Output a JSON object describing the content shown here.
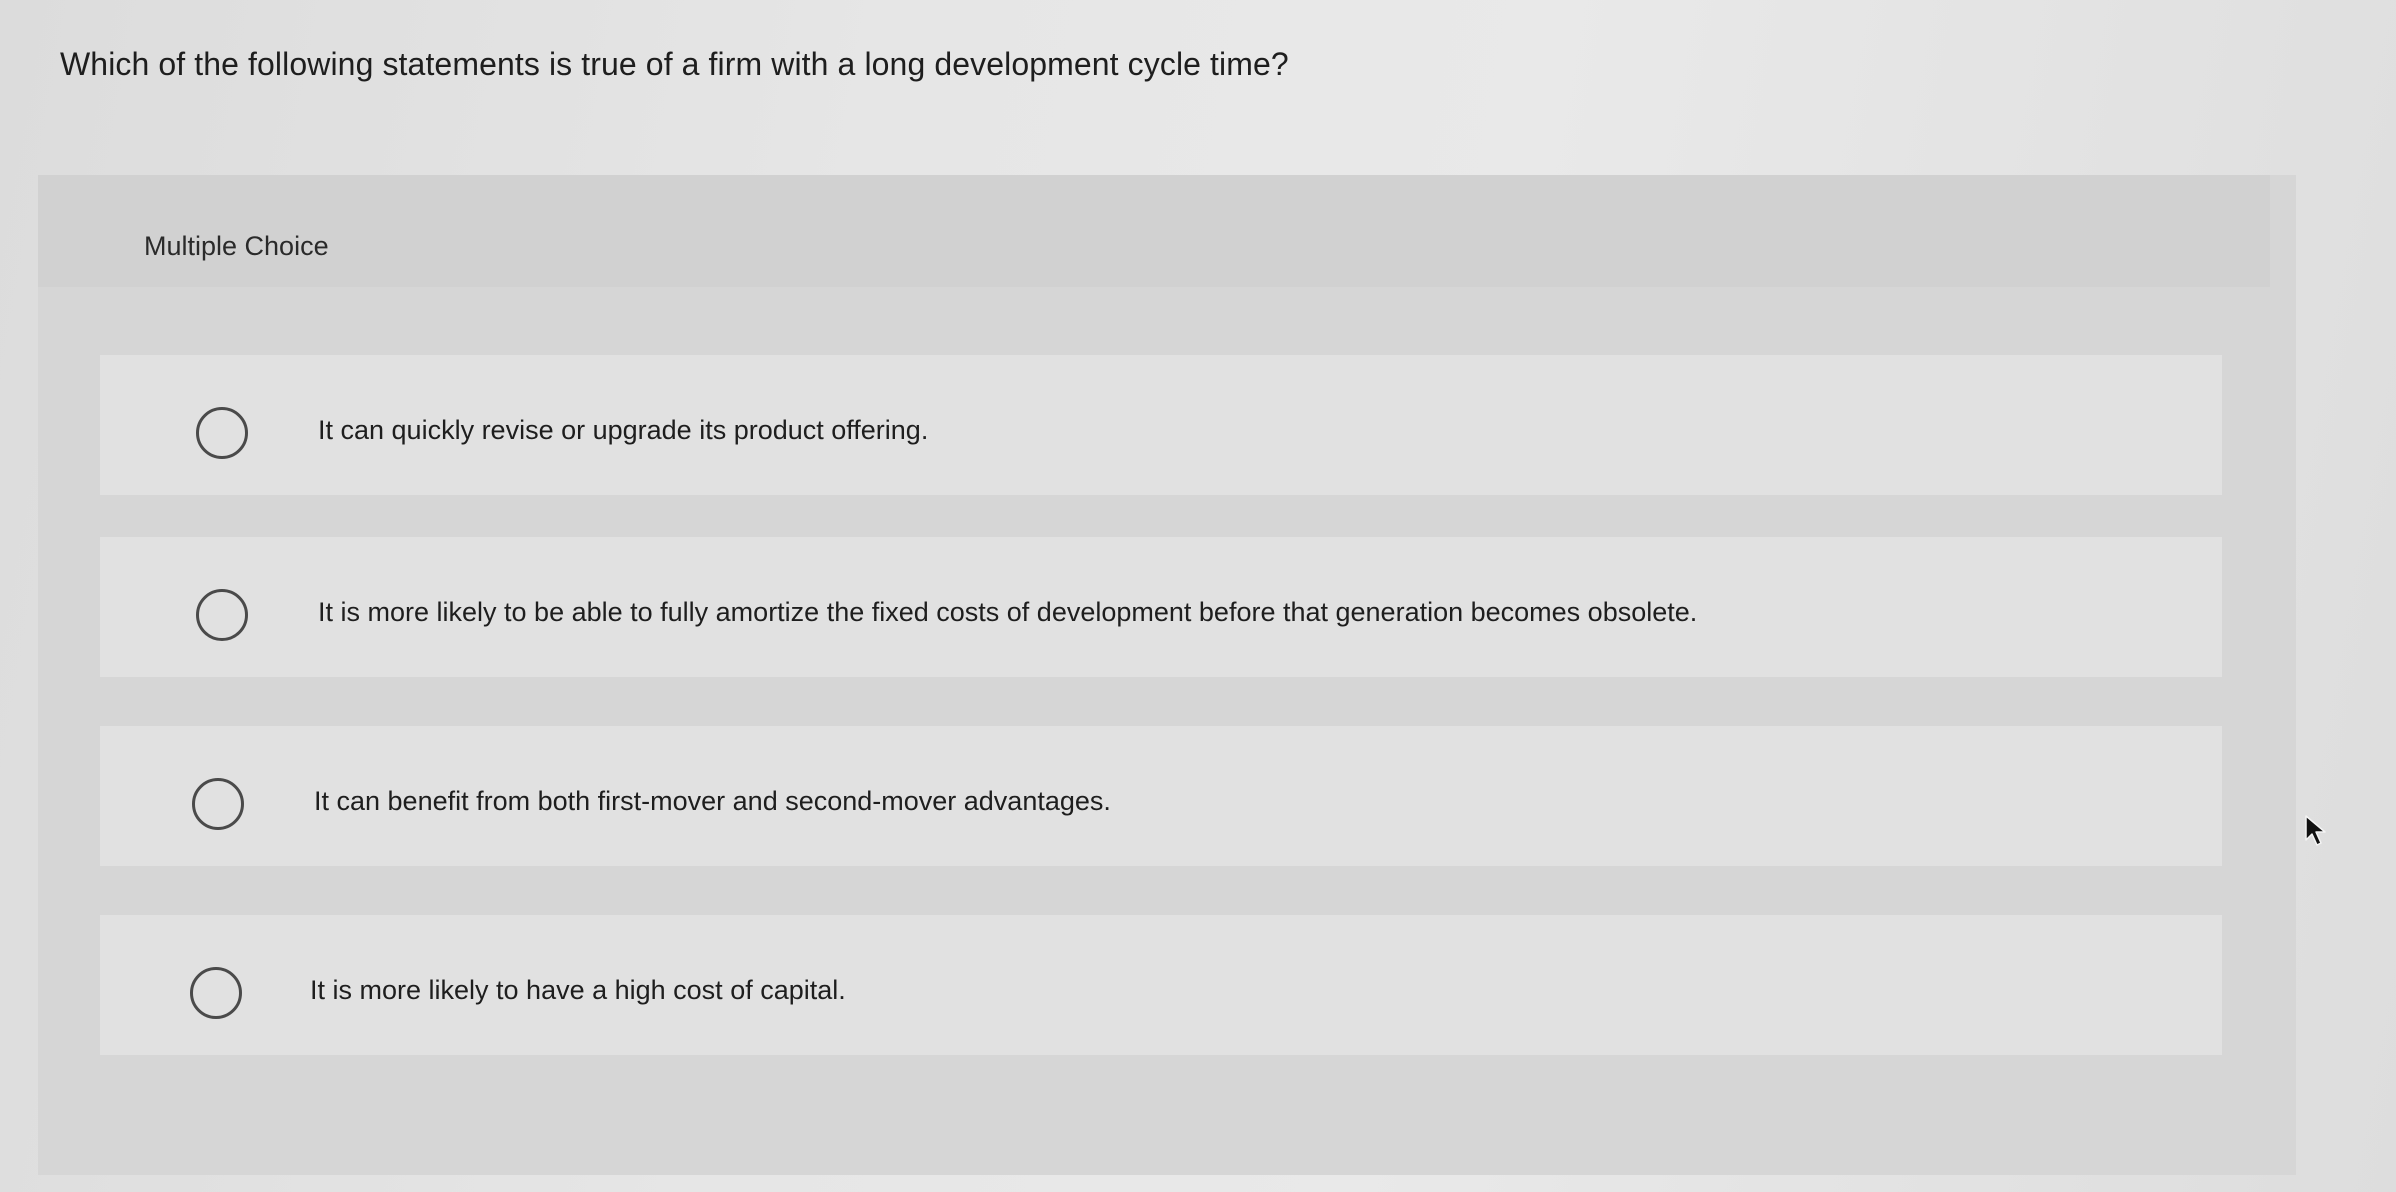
{
  "question": {
    "text": "Which of the following statements is true of a firm with a long development cycle time?"
  },
  "panel": {
    "title": "Multiple Choice"
  },
  "options": [
    {
      "label": "It can quickly revise or upgrade its product offering."
    },
    {
      "label": "It is more likely to be able to fully amortize the fixed costs of development before that generation becomes obsolete."
    },
    {
      "label": "It can benefit from both first-mover and second-mover advantages."
    },
    {
      "label": "It is more likely to have a high cost of capital."
    }
  ],
  "icons": {
    "radio": "radio-unselected-icon",
    "cursor": "mouse-pointer-icon"
  },
  "colors": {
    "background": "#e4e4e4",
    "panel": "#d6d6d6",
    "option_background": "#e1e1e1",
    "text": "#1e1e1e"
  }
}
